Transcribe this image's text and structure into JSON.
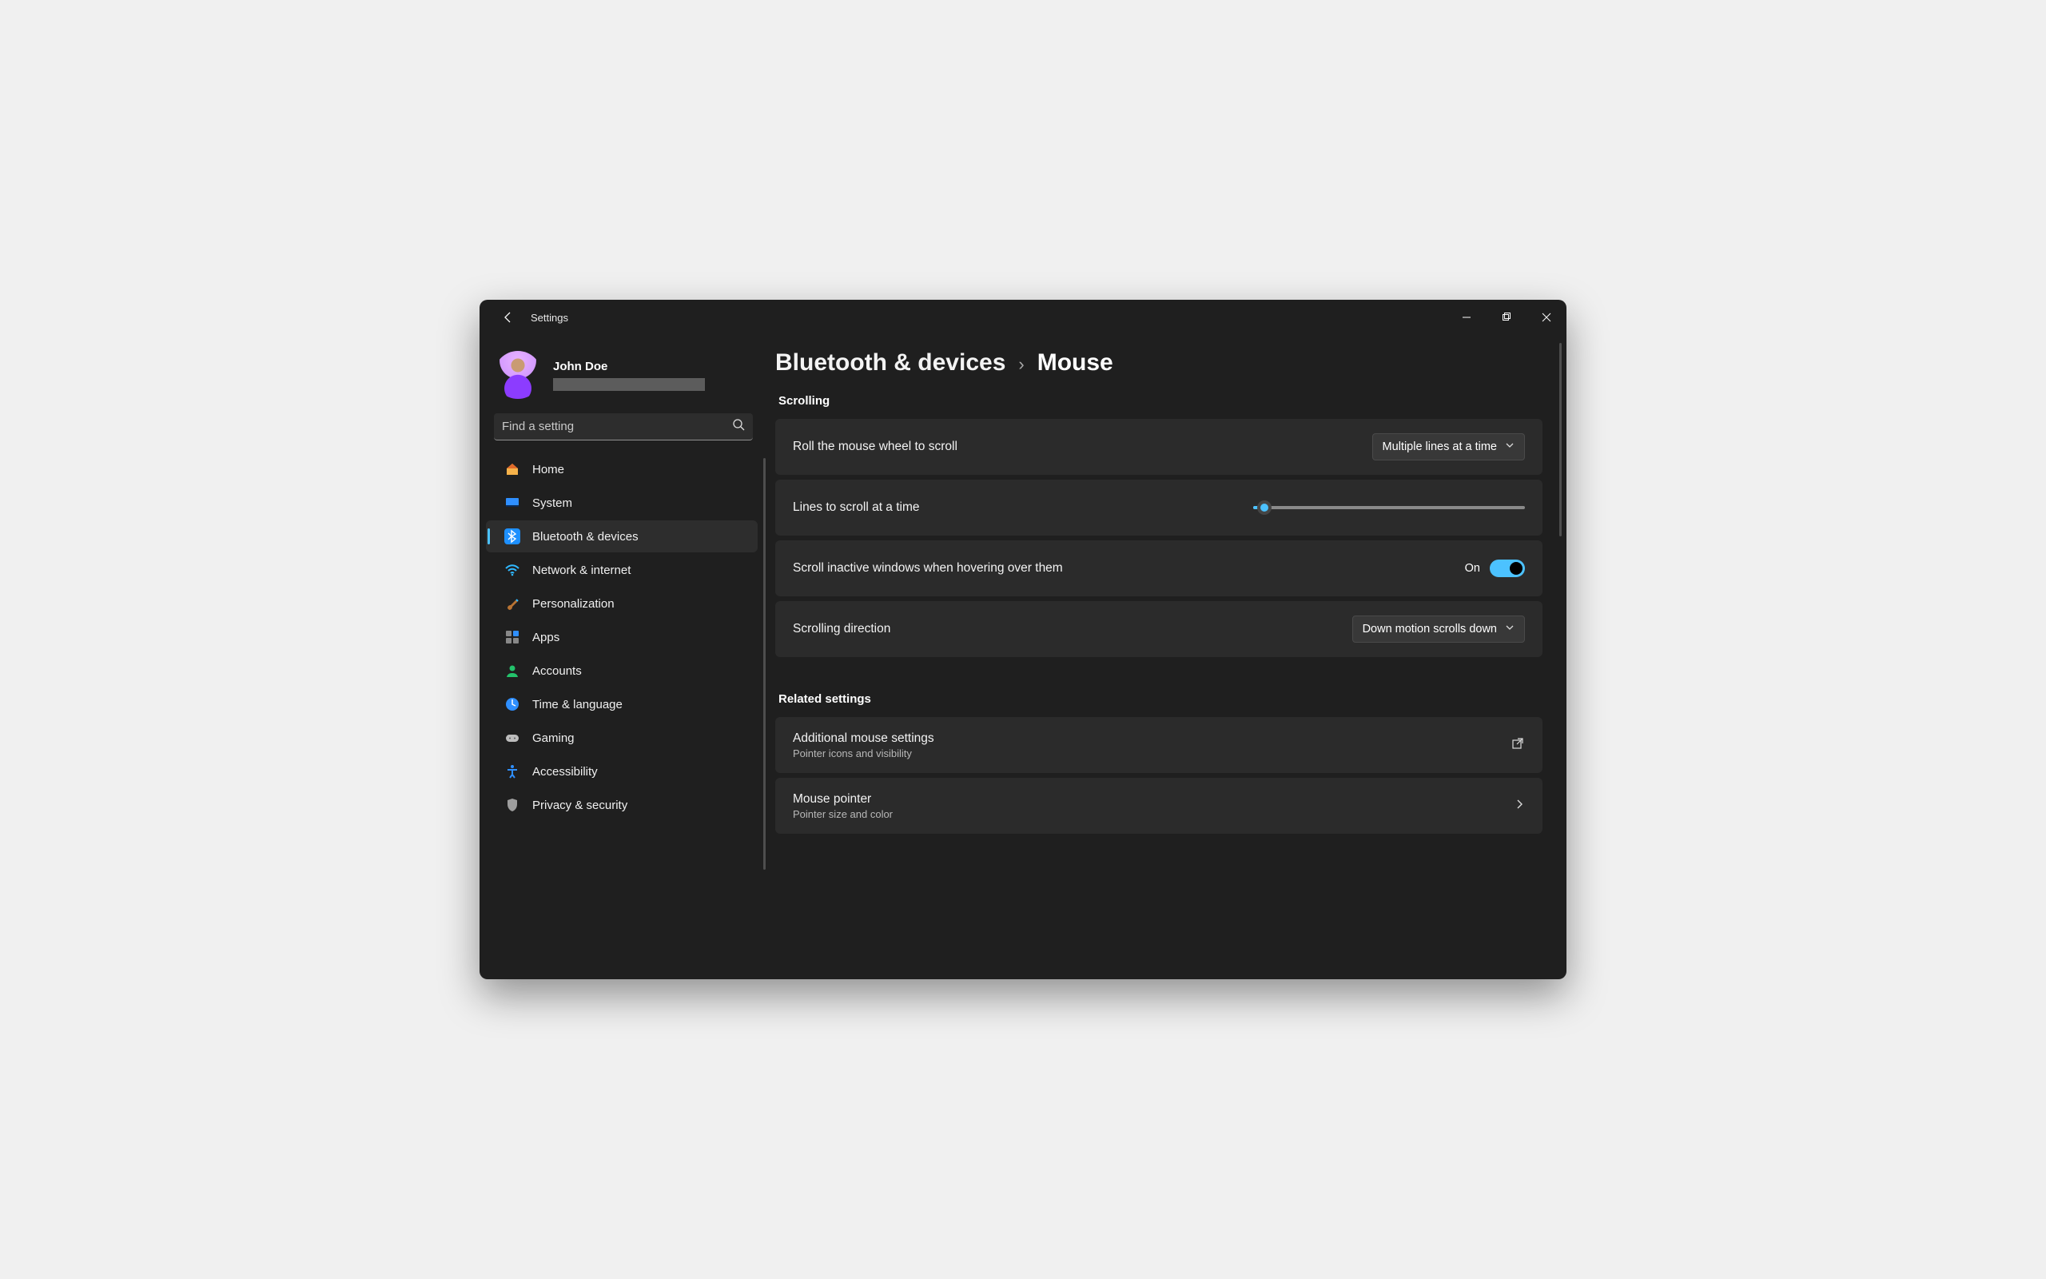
{
  "app": {
    "title": "Settings"
  },
  "profile": {
    "name": "John Doe"
  },
  "search": {
    "placeholder": "Find a setting"
  },
  "sidebar": {
    "items": [
      {
        "label": "Home"
      },
      {
        "label": "System"
      },
      {
        "label": "Bluetooth & devices"
      },
      {
        "label": "Network & internet"
      },
      {
        "label": "Personalization"
      },
      {
        "label": "Apps"
      },
      {
        "label": "Accounts"
      },
      {
        "label": "Time & language"
      },
      {
        "label": "Gaming"
      },
      {
        "label": "Accessibility"
      },
      {
        "label": "Privacy & security"
      }
    ]
  },
  "breadcrumb": {
    "parent": "Bluetooth & devices",
    "leaf": "Mouse"
  },
  "sections": {
    "scrolling": {
      "title": "Scrolling",
      "rollWheel": {
        "label": "Roll the mouse wheel to scroll",
        "value": "Multiple lines at a time"
      },
      "linesToScroll": {
        "label": "Lines to scroll at a time",
        "sliderPercent": 4
      },
      "scrollInactive": {
        "label": "Scroll inactive windows when hovering over them",
        "stateLabel": "On",
        "on": true
      },
      "direction": {
        "label": "Scrolling direction",
        "value": "Down motion scrolls down"
      }
    },
    "related": {
      "title": "Related settings",
      "additional": {
        "label": "Additional mouse settings",
        "sub": "Pointer icons and visibility"
      },
      "pointer": {
        "label": "Mouse pointer",
        "sub": "Pointer size and color"
      }
    }
  }
}
